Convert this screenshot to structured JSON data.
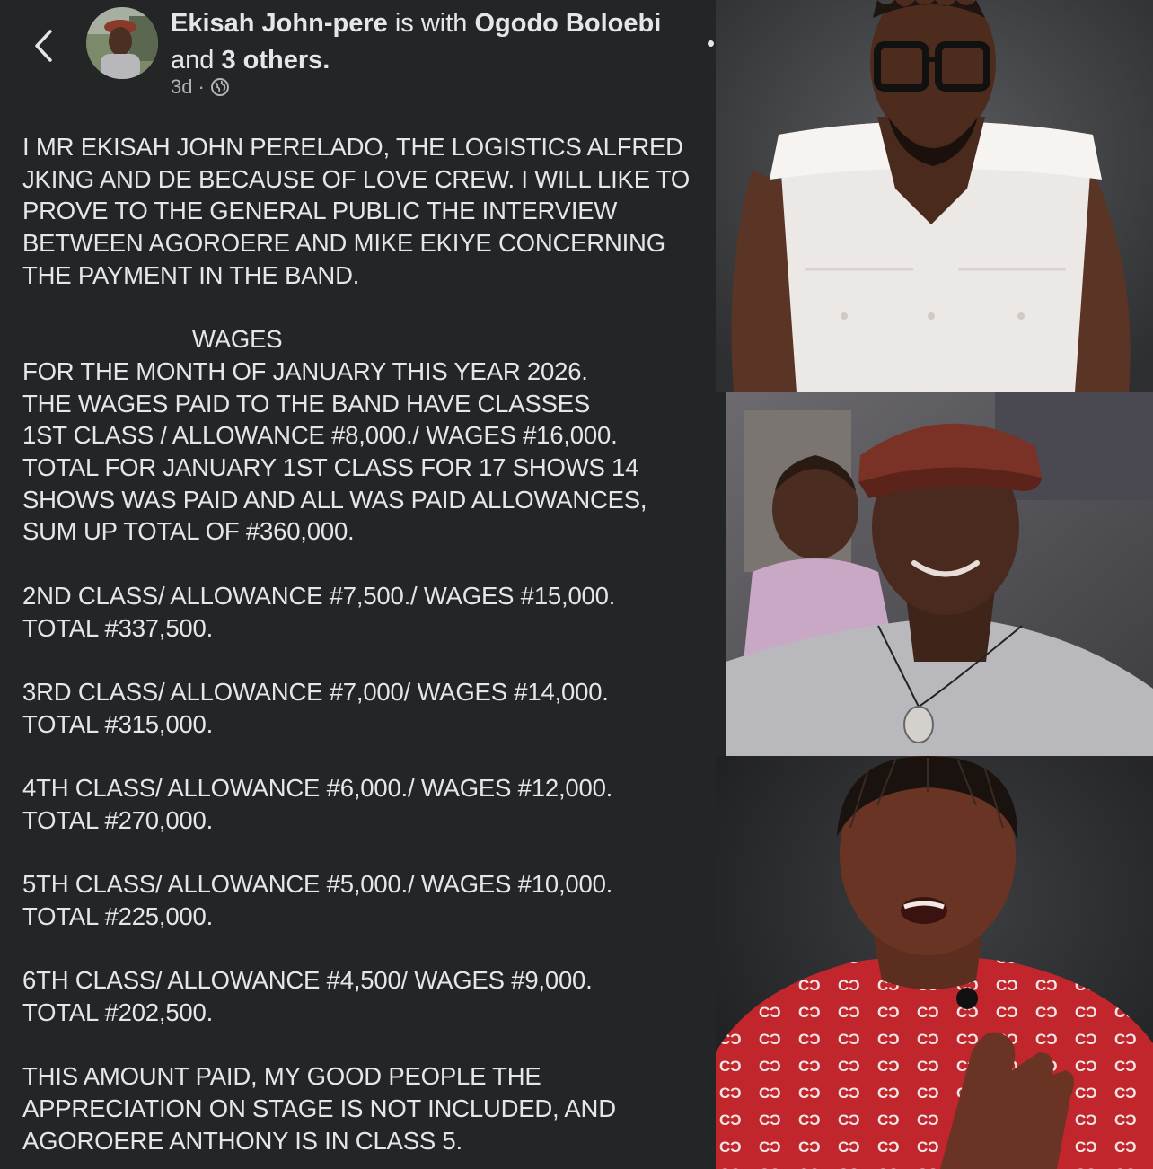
{
  "post": {
    "header": {
      "author": "Ekisah John-pere",
      "with_text": "is with",
      "tagged": "Ogodo Boloebi",
      "and_text": "and",
      "others": "3 others.",
      "time": "3d",
      "dot": "·"
    },
    "body": {
      "intro": [
        "I MR EKISAH JOHN PERELADO, THE LOGISTICS ALFRED",
        "JKING AND DE BECAUSE OF LOVE CREW. I WILL LIKE TO",
        "PROVE TO THE GENERAL PUBLIC THE INTERVIEW",
        "BETWEEN AGOROERE AND MIKE EKIYE CONCERNING",
        "THE PAYMENT IN THE BAND."
      ],
      "wages_heading": "WAGES",
      "class1": [
        "FOR THE MONTH OF JANUARY THIS YEAR 2026.",
        "THE WAGES PAID TO THE BAND HAVE CLASSES",
        "1ST CLASS / ALLOWANCE #8,000./ WAGES #16,000.",
        "TOTAL FOR JANUARY 1ST CLASS FOR 17 SHOWS 14",
        "SHOWS WAS PAID AND ALL WAS PAID ALLOWANCES,",
        "SUM UP TOTAL OF #360,000."
      ],
      "class2": [
        "2ND CLASS/ ALLOWANCE #7,500./ WAGES #15,000.",
        "TOTAL #337,500."
      ],
      "class3": [
        "3RD CLASS/ ALLOWANCE #7,000/ WAGES #14,000.",
        "TOTAL #315,000."
      ],
      "class4": [
        "4TH CLASS/ ALLOWANCE #6,000./ WAGES #12,000.",
        "TOTAL #270,000."
      ],
      "class5": [
        "5TH CLASS/ ALLOWANCE #5,000./ WAGES #10,000.",
        "TOTAL #225,000."
      ],
      "class6": [
        "6TH CLASS/ ALLOWANCE #4,500/ WAGES #9,000.",
        "TOTAL #202,500."
      ],
      "closing": [
        "THIS AMOUNT PAID, MY GOOD PEOPLE THE",
        "APPRECIATION ON STAGE IS NOT INCLUDED, AND",
        "AGOROERE ANTHONY IS IN CLASS 5."
      ]
    }
  },
  "icons": {
    "back": "chevron-left-icon",
    "more": "more-horizontal-icon",
    "audience": "globe-icon"
  },
  "colors": {
    "post_background": "#242526",
    "primary_text": "#e4e6eb",
    "secondary_text": "#b0b3b8"
  }
}
